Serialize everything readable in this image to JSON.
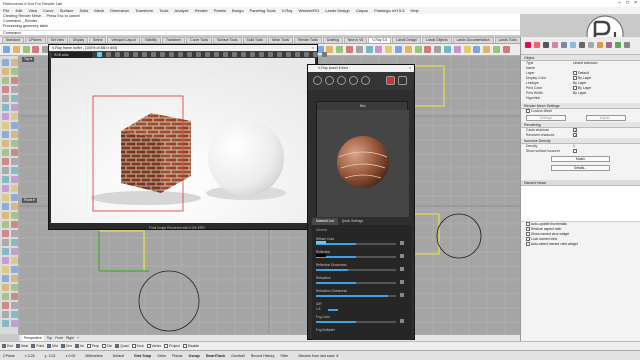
{
  "window": {
    "title": "Rhinoceros 6 Not For Resale Lab"
  },
  "menu": [
    "File",
    "Edit",
    "View",
    "Curve",
    "Surface",
    "Solid",
    "Mesh",
    "Dimension",
    "Transform",
    "Tools",
    "Analyze",
    "Render",
    "Panels",
    "Bongo",
    "Paneling Tools",
    "V-Ray",
    "Weaver/RG",
    "Lands Design",
    "Clayoo",
    "Flamingo nXt 5.5",
    "Help"
  ],
  "command_history": [
    "Creating Render Mesh ... Press Esc to cancel",
    "Command: _Render",
    "Processing geometry table",
    "Command:"
  ],
  "toolbar_tabs": [
    "Standard",
    "CPlanes",
    "Set View",
    "Display",
    "Select",
    "Viewport Layout",
    "Visibility",
    "Transform",
    "Curve Tools",
    "Surface Tools",
    "Solid Tools",
    "Mesh Tools",
    "Render Tools",
    "Drafting",
    "New in V6",
    "V-Ray 3.6",
    "Lands Design",
    "Lands Objects",
    "Lands Documentation",
    "Lands Tools",
    "SubD",
    "Bongo"
  ],
  "active_toolbar_tab": "V-Ray 3.6",
  "viewports": {
    "top_label": "Top ▾",
    "bottom_label": "Front ▾",
    "tabs": [
      "Perspective",
      "Top",
      "Front",
      "Right",
      "+"
    ]
  },
  "render_window": {
    "title": "V-Ray frame buffer - [100% of 880 x 600]",
    "channel": "RGB color",
    "status": "Final Image Rendered with 0.0% ERR",
    "colors": {
      "brick": "#9b4a2c",
      "mortar": "#d8c8b8",
      "sphere": "#f2f2f2",
      "region": "#e0302a"
    }
  },
  "material_editor": {
    "title": "V-Ray Asset Editor",
    "material_name": "Bric",
    "subtabs": [
      "Material List",
      "Quick Settings"
    ],
    "section": "Generic",
    "params": [
      {
        "label": "Diffuse Color",
        "value": 0.5,
        "swatch": "#6cc9f4"
      },
      {
        "label": "Reflection",
        "value": 0.5,
        "swatch": "#000000"
      },
      {
        "label": "Reflection Glossiness",
        "value": 0.4
      },
      {
        "label": "Refraction",
        "value": 0.5
      },
      {
        "label": "Refraction Glossiness",
        "value": 0.9
      },
      {
        "label": "IOR",
        "value": "1.6"
      },
      {
        "label": "Fog Color",
        "value": 0.5
      },
      {
        "label": "Fog Multiplier",
        "value": ""
      }
    ]
  },
  "properties": {
    "title": "Object",
    "rows": [
      {
        "k": "Type",
        "v": "closed extrusion"
      },
      {
        "k": "Name",
        "v": ""
      },
      {
        "k": "Layer",
        "v": "Default"
      },
      {
        "k": "Display Color",
        "v": "By Layer"
      },
      {
        "k": "Linetype",
        "v": "By Layer"
      },
      {
        "k": "Print Color",
        "v": "By Layer"
      },
      {
        "k": "Print Width",
        "v": "By Layer"
      },
      {
        "k": "Hyperlink",
        "v": ""
      }
    ],
    "render_mesh_title": "Render Mesh Settings",
    "custom_mesh": "Custom Mesh",
    "settings_btn": "Settings",
    "adjust_btn": "Adjust...",
    "rendering_title": "Rendering",
    "casts_shadows": "Casts shadows",
    "receives_shadows": "Receives shadows",
    "isocurve_title": "Isocurve Density",
    "density_label": "Density",
    "density_value": "1",
    "show_isocurve": "Show surface isocurve",
    "match_btn": "Match",
    "details_btn": "Details...",
    "named_views_title": "Named Views",
    "nv_options": [
      "Auto-update thumbnails",
      "Restore aspect ratio",
      "Show named view widget",
      "Lock named view",
      "Auto-select named view widget"
    ]
  },
  "osnaps": [
    {
      "label": "End",
      "on": true
    },
    {
      "label": "Near",
      "on": true
    },
    {
      "label": "Point",
      "on": true
    },
    {
      "label": "Mid",
      "on": true
    },
    {
      "label": "Cen",
      "on": true
    },
    {
      "label": "Int",
      "on": true
    },
    {
      "label": "Perp",
      "on": false
    },
    {
      "label": "Tan",
      "on": false
    },
    {
      "label": "Quad",
      "on": true
    },
    {
      "label": "Knot",
      "on": false
    },
    {
      "label": "Vertex",
      "on": false
    },
    {
      "label": "Project",
      "on": false
    },
    {
      "label": "Disable",
      "on": false
    }
  ],
  "status": {
    "cplane": "CPlane",
    "x": "x 3.26",
    "y": "y -3.01",
    "z": "z 0.00",
    "units": "Millimeters",
    "layer": "Default",
    "toggles": [
      "Grid Snap",
      "Ortho",
      "Planar",
      "Osnap",
      "SmartTrack",
      "Gumball",
      "Record History",
      "Filter"
    ],
    "message": "Minutes from last save: 8"
  },
  "logo": {
    "text": "PeL"
  }
}
